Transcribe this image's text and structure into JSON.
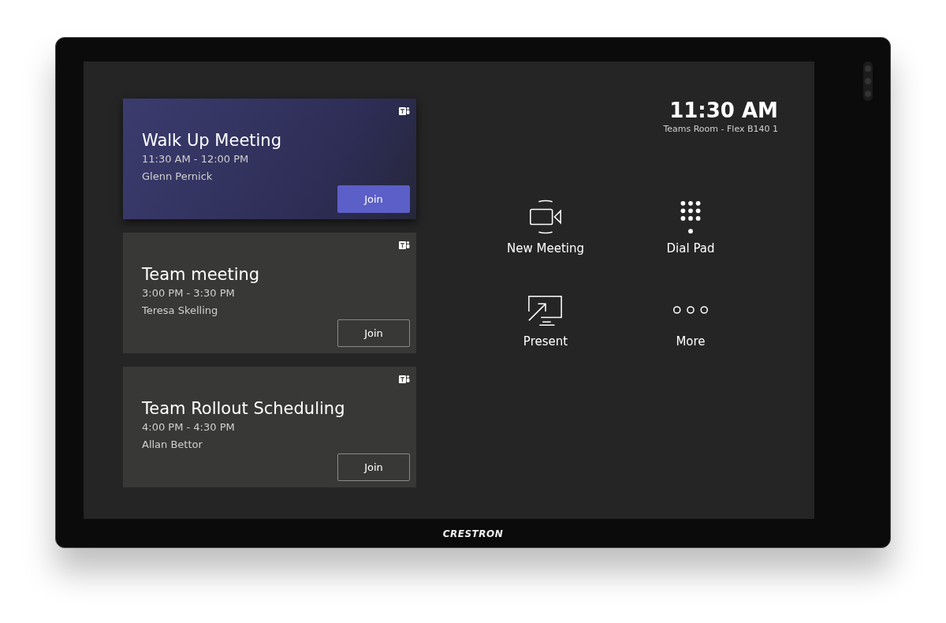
{
  "clock": {
    "time": "11:30 AM",
    "room": "Teams Room - Flex B140 1"
  },
  "meetings": [
    {
      "title": "Walk Up Meeting",
      "time": "11:30 AM - 12:00 PM",
      "organizer": "Glenn Pernick",
      "join": "Join",
      "selected": true
    },
    {
      "title": "Team meeting",
      "time": "3:00 PM - 3:30 PM",
      "organizer": "Teresa Skelling",
      "join": "Join",
      "selected": false
    },
    {
      "title": "Team Rollout Scheduling",
      "time": "4:00 PM - 4:30 PM",
      "organizer": "Allan Bettor",
      "join": "Join",
      "selected": false
    }
  ],
  "actions": [
    {
      "kind": "video",
      "label": "New Meeting"
    },
    {
      "kind": "dialpad",
      "label": "Dial Pad"
    },
    {
      "kind": "present",
      "label": "Present"
    },
    {
      "kind": "more",
      "label": "More"
    }
  ],
  "brand": "CRESTRON"
}
